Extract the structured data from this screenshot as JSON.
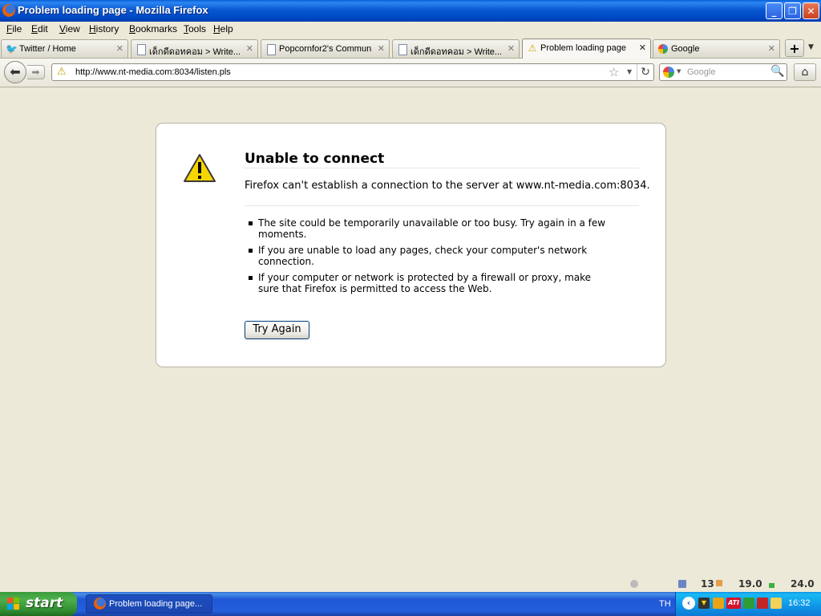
{
  "window": {
    "title": "Problem loading page - Mozilla Firefox",
    "minimize": "_",
    "maximize": "❐",
    "close": "✕"
  },
  "menu": {
    "items": [
      {
        "accel": "F",
        "rest": "ile"
      },
      {
        "accel": "E",
        "rest": "dit"
      },
      {
        "accel": "V",
        "rest": "iew"
      },
      {
        "accel": "H",
        "rest": "istory"
      },
      {
        "accel": "B",
        "rest": "ookmarks"
      },
      {
        "accel": "T",
        "rest": "ools"
      },
      {
        "accel": "H",
        "rest": "elp"
      }
    ]
  },
  "tabs": [
    {
      "label": "Twitter / Home",
      "icon": "twitter-bird-icon",
      "active": false
    },
    {
      "label": "เด็กดีดอทคอม > Write...",
      "icon": "page-icon",
      "active": false
    },
    {
      "label": "Popcornfor2's Commun...",
      "icon": "page-icon",
      "active": false
    },
    {
      "label": "เด็กดีดอทคอม > Write...",
      "icon": "page-icon",
      "active": false
    },
    {
      "label": "Problem loading page",
      "icon": "warning-icon",
      "active": true
    },
    {
      "label": "Google",
      "icon": "google-icon",
      "active": false
    }
  ],
  "tab_close": "✕",
  "new_tab": "+",
  "nav": {
    "url": "http://www.nt-media.com:8034/listen.pls",
    "search_placeholder": "Google"
  },
  "error": {
    "title": "Unable to connect",
    "description": "Firefox can't establish a connection to the server at www.nt-media.com:8034.",
    "bullets": [
      "The site could be temporarily unavailable or too busy. Try again in a few moments.",
      "If you are unable to load any pages, check your computer's network connection.",
      "If your computer or network is protected by a firewall or proxy, make sure that Firefox is permitted to access the Web."
    ],
    "button": "Try Again"
  },
  "statusbar": {
    "value1": "13",
    "value2": "19.0",
    "value3": "24.0"
  },
  "taskbar": {
    "start": "start",
    "task_label": "Problem loading page...",
    "language": "TH",
    "clock": "16:32"
  },
  "colors": {
    "titlebar": "#0a58d0",
    "taskbar": "#245edb",
    "start": "#3c9b3c",
    "content_bg": "#ece9d8"
  }
}
